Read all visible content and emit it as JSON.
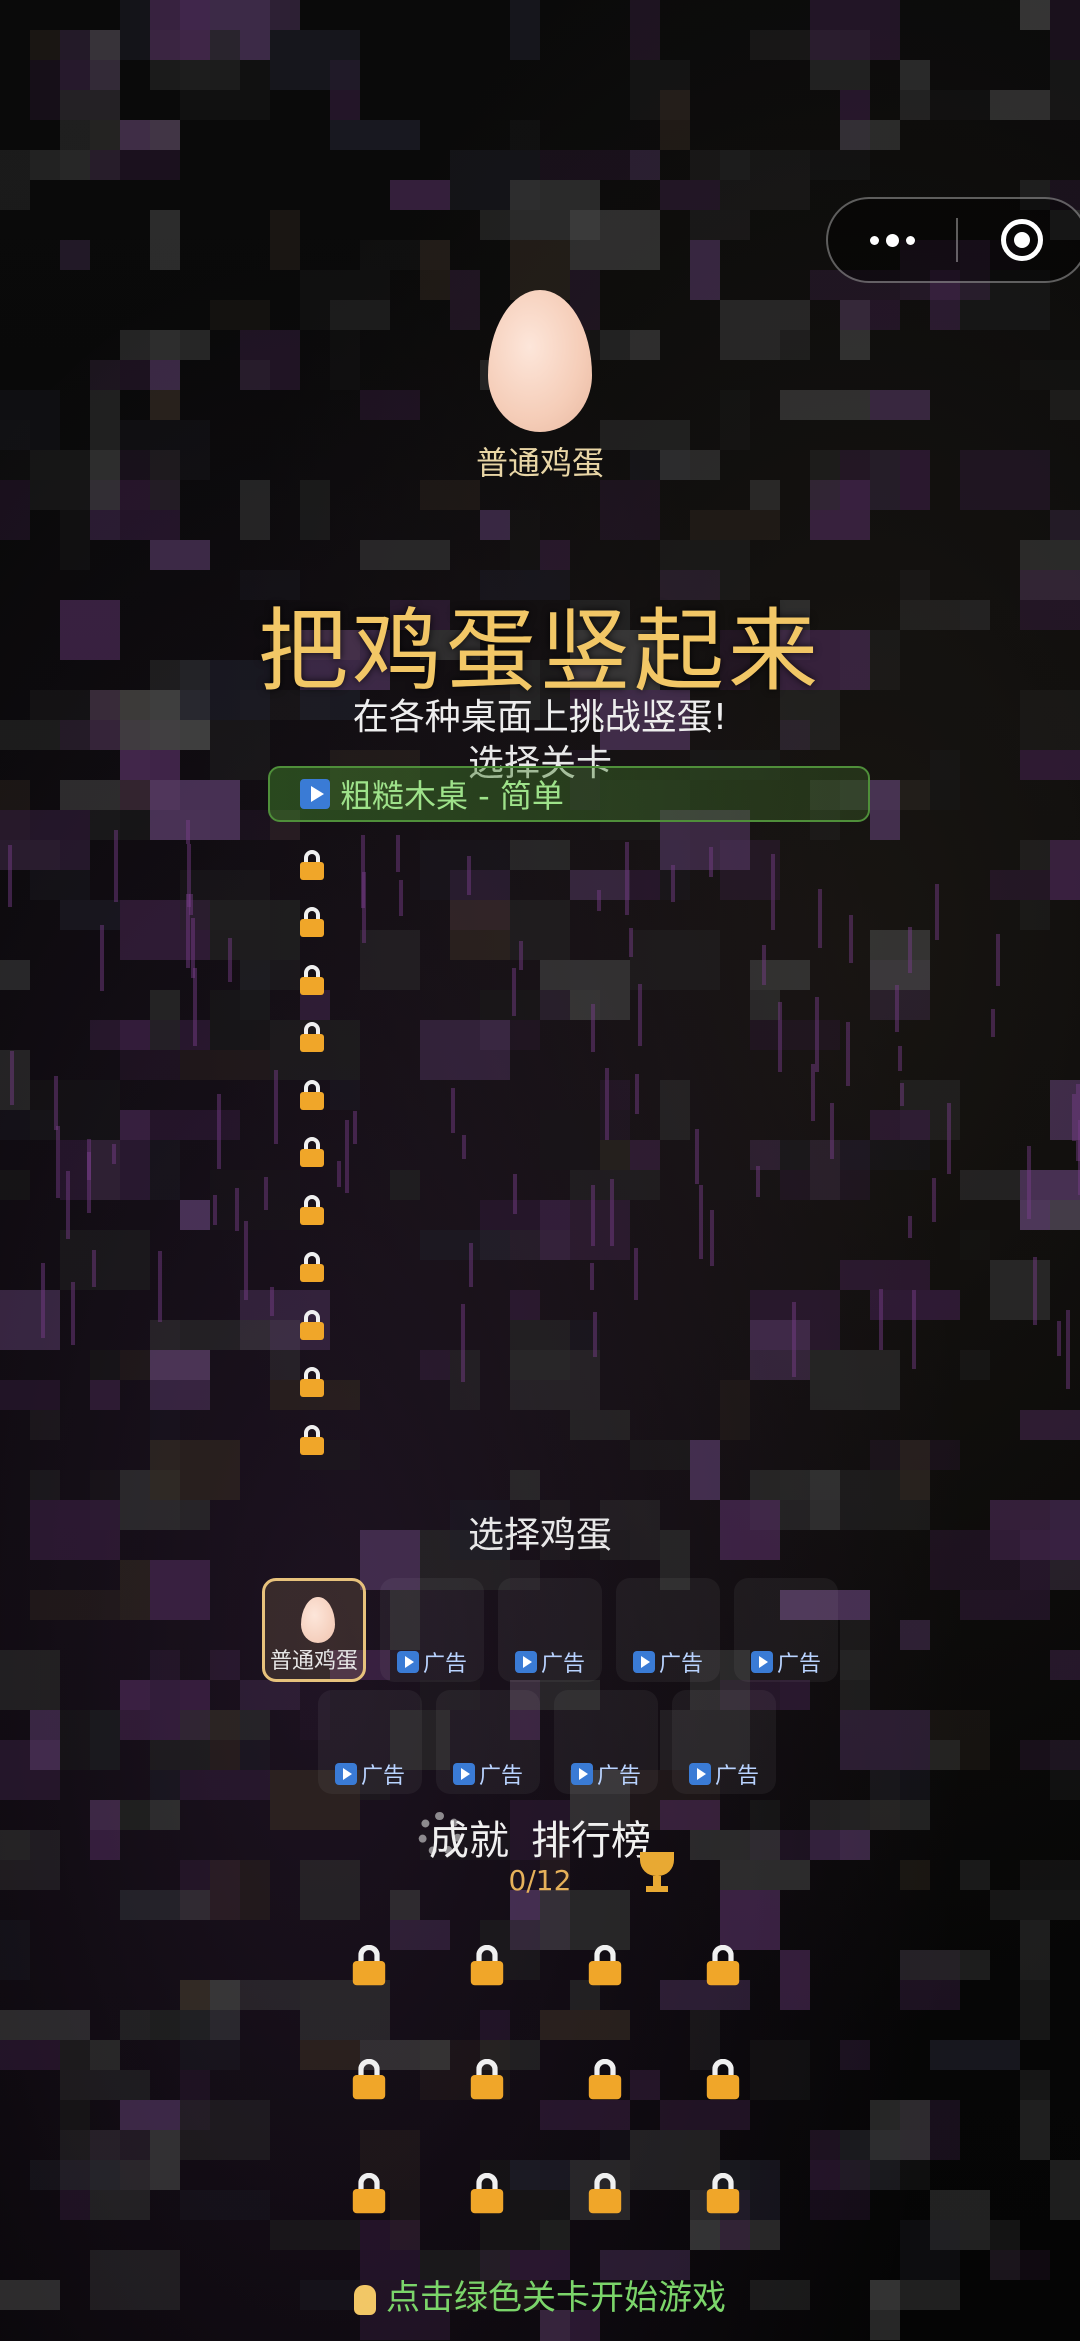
{
  "toolbar": {
    "more_icon": "dots-icon",
    "close_icon": "target-icon"
  },
  "hero": {
    "egg_name": "普通鸡蛋"
  },
  "title": "把鸡蛋竖起来",
  "subtitle": "在各种桌面上挑战竖蛋!",
  "levels": {
    "section_title": "选择关卡",
    "first": {
      "label": "粗糙木桌 - 简单"
    },
    "locked_count": 11
  },
  "eggs": {
    "section_title": "选择鸡蛋",
    "row1": [
      {
        "label": "普通鸡蛋",
        "selected": true,
        "ad": false
      },
      {
        "label": "广告",
        "selected": false,
        "ad": true
      },
      {
        "label": "广告",
        "selected": false,
        "ad": true
      },
      {
        "label": "广告",
        "selected": false,
        "ad": true
      },
      {
        "label": "广告",
        "selected": false,
        "ad": true
      }
    ],
    "row2": [
      {
        "label": "广告",
        "selected": false,
        "ad": true
      },
      {
        "label": "广告",
        "selected": false,
        "ad": true
      },
      {
        "label": "广告",
        "selected": false,
        "ad": true
      },
      {
        "label": "广告",
        "selected": false,
        "ad": true
      }
    ]
  },
  "tabs": {
    "achievements": "成就",
    "leaderboard": "排行榜"
  },
  "progress": "0/12",
  "hint": "点击绿色关卡开始游戏",
  "colors": {
    "title": "#f2c766",
    "level_green": "#9ee28a",
    "lock": "#f0a629"
  }
}
